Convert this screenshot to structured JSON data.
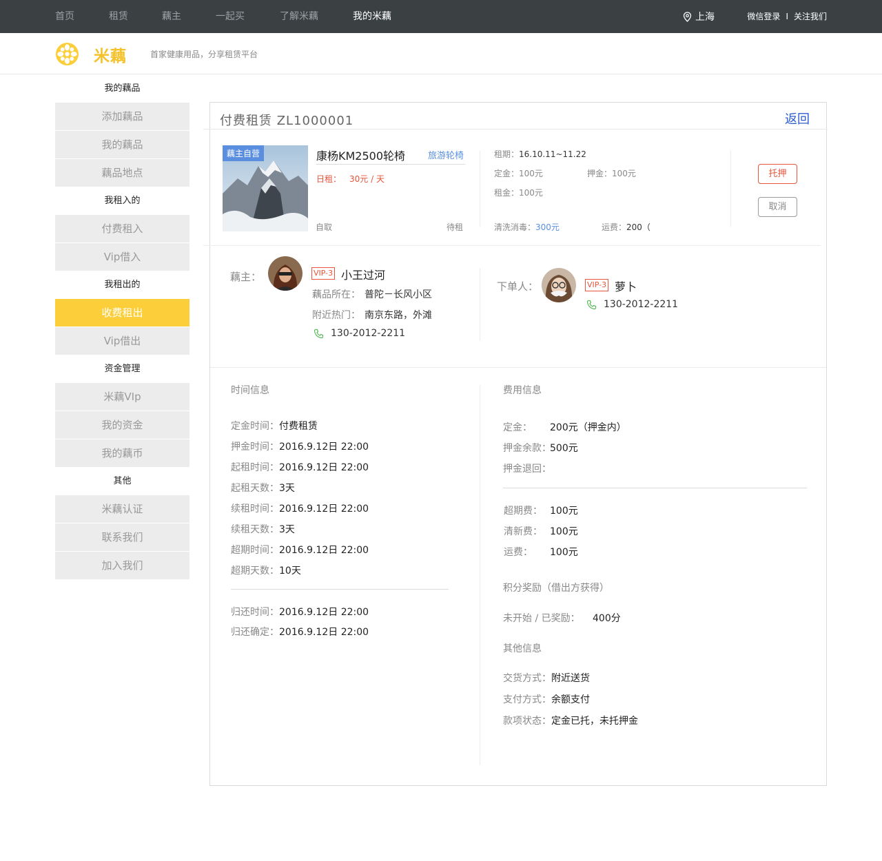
{
  "topnav": {
    "items": [
      "首页",
      "租赁",
      "藕主",
      "一起买",
      "了解米藕",
      "我的米藕"
    ],
    "city": "上海",
    "login": "微信登录",
    "sep": "I",
    "follow": "关注我们"
  },
  "header": {
    "brand": "米藕",
    "slogan": "首家健康用品，分享租赁平台"
  },
  "sidebar": {
    "g1": "我的藕品",
    "g1_items": [
      "添加藕品",
      "我的藕品",
      "藕品地点"
    ],
    "g2": "我租入的",
    "g2_items": [
      "付费租入",
      "Vip借入"
    ],
    "g3": "我租出的",
    "g3_items": [
      "收费租出",
      "Vip借出"
    ],
    "g4": "资金管理",
    "g4_items": [
      "米藕VIp",
      "我的资金",
      "我的藕币"
    ],
    "g5": "其他",
    "g5_items": [
      "米藕认证",
      "联系我们",
      "加入我们"
    ]
  },
  "order": {
    "title": "付费租赁 ZL1000001",
    "back": "返回",
    "product": {
      "tag": "藕主自营",
      "name": "康杨KM2500轮椅",
      "category": "旅游轮椅",
      "rent_label": "日租：",
      "rent_value": "30元 / 天",
      "pickup": "自取",
      "status": "待租"
    },
    "terms": {
      "period_label": "租期：",
      "period_value": "16.10.11~11.22",
      "deposit_label": "定金：",
      "deposit_value": "100元",
      "pledge_label": "押金：",
      "pledge_value": "100元",
      "rent_label": "租金：",
      "rent_value": "100元",
      "clean_label": "清洗消毒：",
      "clean_value": "300元",
      "ship_label": "运费：",
      "ship_value": "200（"
    },
    "actions": {
      "escrow": "托押",
      "cancel": "取消"
    }
  },
  "owner": {
    "label": "藕主：",
    "vip": "VIP-3",
    "name": "小王过河",
    "loc_label": "藕品所在：",
    "loc_value": "普陀－长风小区",
    "near_label": "附近热门：",
    "near_value": "南京东路，外滩",
    "phone": "130-2012-2211"
  },
  "buyer": {
    "label": "下单人：",
    "vip": "VIP-3",
    "name": "萝卜",
    "phone": "130-2012-2211"
  },
  "time_info": {
    "title": "时间信息",
    "rows": [
      {
        "k": "定金时间：",
        "v": "付费租赁"
      },
      {
        "k": "押金时间：",
        "v": "2016.9.12日 22:00"
      },
      {
        "k": "起租时间：",
        "v": "2016.9.12日 22:00"
      },
      {
        "k": "起租天数：",
        "v": "3天"
      },
      {
        "k": "续租时间：",
        "v": "2016.9.12日 22:00"
      },
      {
        "k": "续租天数：",
        "v": "3天"
      },
      {
        "k": "超期时间：",
        "v": "2016.9.12日 22:00"
      },
      {
        "k": "超期天数：",
        "v": "10天"
      }
    ],
    "rows2": [
      {
        "k": "归还时间：",
        "v": "2016.9.12日 22:00"
      },
      {
        "k": "归还确定：",
        "v": "2016.9.12日 22:00"
      }
    ]
  },
  "fee_info": {
    "title": "费用信息",
    "rows": [
      {
        "k": "定金：",
        "v": "200元（押金内）"
      },
      {
        "k": "押金余款：",
        "v": "500元"
      },
      {
        "k": "押金退回：",
        "v": ""
      }
    ],
    "rows2": [
      {
        "k": "超期费：",
        "v": "100元"
      },
      {
        "k": "清新费：",
        "v": "100元"
      },
      {
        "k": "运费：",
        "v": "100元"
      }
    ],
    "points_title": "积分奖励（借出方获得）",
    "points_label": "未开始 / 已奖励：",
    "points_value": "400分",
    "other_title": "其他信息",
    "other_rows": [
      {
        "k": "交货方式：",
        "v": "附近送货"
      },
      {
        "k": "支付方式：",
        "v": "余额支付"
      },
      {
        "k": "款项状态：",
        "v": "定金已托，未托押金"
      }
    ]
  },
  "colors": {
    "brand_yellow": "#fccf3a",
    "accent_red": "#e8533a",
    "link_blue": "#5a8fe0",
    "topbar": "#3b4043"
  }
}
